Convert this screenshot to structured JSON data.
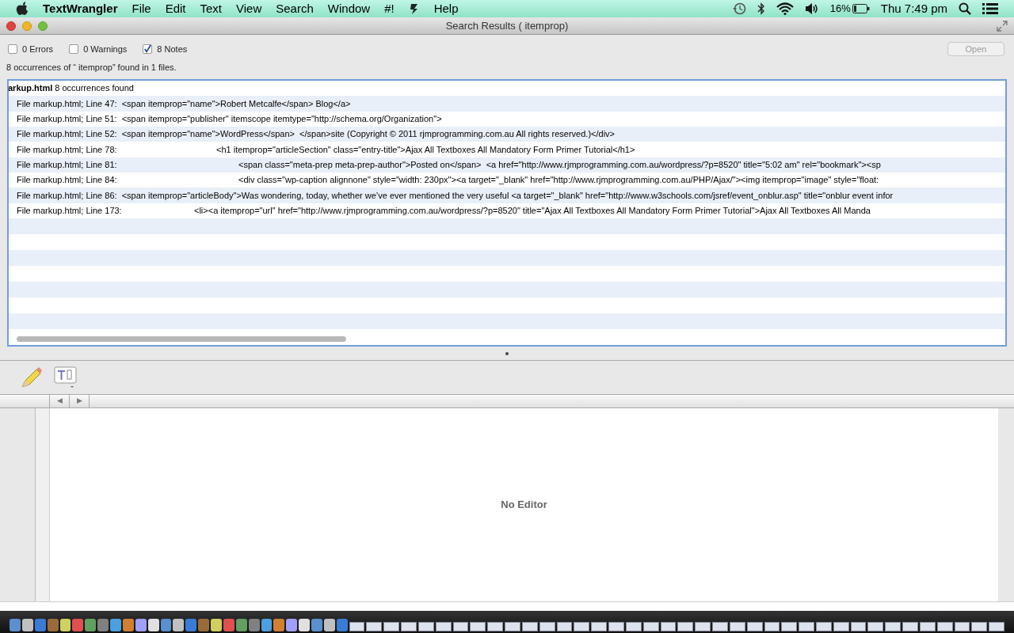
{
  "menubar": {
    "app_name": "TextWrangler",
    "menus": [
      "File",
      "Edit",
      "Text",
      "View",
      "Search",
      "Window",
      "#!",
      "Help"
    ],
    "battery_percent": "16%",
    "clock": "Thu 7:49 pm"
  },
  "window": {
    "title": "Search Results ( itemprop)",
    "filters": [
      {
        "label": "0 Errors",
        "checked": false
      },
      {
        "label": "0 Warnings",
        "checked": false
      },
      {
        "label": "8 Notes",
        "checked": true
      }
    ],
    "open_button": {
      "label": "Open",
      "disabled": true
    },
    "summary": "8 occurrences of “ itemprop” found in 1 files.",
    "results": {
      "file_header": "**arkup.html** 8 occurrences found",
      "rows": [
        "File markup.html; Line 47:  <span itemprop=\"name\">Robert Metcalfe</span> Blog</a>",
        "File markup.html; Line 51:  <span itemprop=\"publisher\" itemscope itemtype=\"http://schema.org/Organization\">",
        "File markup.html; Line 52:  <span itemprop=\"name\">WordPress</span>  </span>site (Copyright © 2011 rjmprogramming.com.au All rights reserved.)</div>",
        "File markup.html; Line 78:\t\t\t\t\t<h1 itemprop=\"articleSection\" class=\"entry-title\">Ajax All Textboxes All Mandatory Form Primer Tutorial</h1>",
        "File markup.html; Line 81:\t\t\t\t\t\t<span class=\"meta-prep meta-prep-author\">Posted on</span>  <a href=\"http://www.rjmprogramming.com.au/wordpress/?p=8520\" title=\"5:02 am\" rel=\"bookmark\"><sp",
        "File markup.html; Line 84:\t\t\t\t\t\t<div class=\"wp-caption alignnone\" style=\"width: 230px\"><a target=\"_blank\" href=\"http://www.rjmprogramming.com.au/PHP/Ajax/\"><img itemprop=\"image\" style=\"float:",
        "File markup.html; Line 86:  <span itemprop=\"articleBody\">Was wondering, today, whether we’ve ever mentioned the very useful <a target=\"_blank\" href=\"http://www.w3schools.com/jsref/event_onblur.asp\" title=\"onblur event infor",
        "File markup.html; Line 173:\t\t\t\t<li><a itemprop=\"url\" href=\"http://www.rjmprogramming.com.au/wordpress/?p=8520\" title=\"Ajax All Textboxes All Mandatory Form Primer Tutorial\">Ajax All Textboxes All Manda"
      ]
    }
  },
  "nav": {
    "prev": "◀",
    "next": "▶"
  },
  "editor": {
    "message": "No Editor"
  }
}
